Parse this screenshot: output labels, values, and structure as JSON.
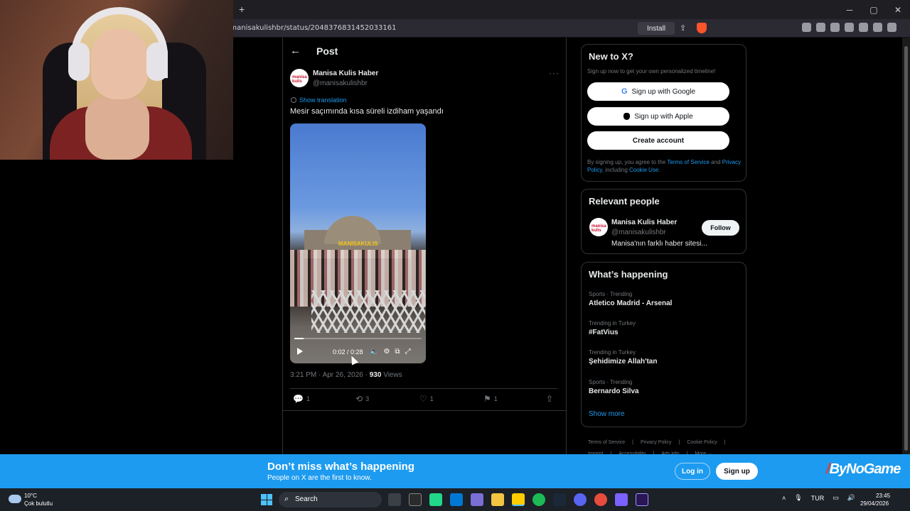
{
  "browser": {
    "new_tab": "+",
    "url": "/manisakulishbr/status/2048376831452033161",
    "install_label": "Install",
    "window_controls": [
      "─",
      "▢",
      "✕"
    ]
  },
  "post": {
    "header_title": "Post",
    "author_name": "Manisa Kulis Haber",
    "author_handle": "@manisakulishbr",
    "avatar_text": "manisa kulis",
    "show_translation": "Show translation",
    "text": "Mesir saçımında kısa süreli izdiham yaşandı",
    "video_watermark": "MANISAKULIS",
    "video_time": "0:02 / 0:28",
    "video_progress": 0.07,
    "timestamp": "3:21 PM · Apr 26, 2026 · ",
    "views_count": "930",
    "views_label": " Views",
    "replies": "1",
    "reposts": "3",
    "likes": "1",
    "bookmarks": "1"
  },
  "sidebar": {
    "signup": {
      "title": "New to X?",
      "subtitle": "Sign up now to get your own personalized timeline!",
      "google": "Sign up with Google",
      "apple": "Sign up with Apple",
      "create": "Create account",
      "terms_prefix": "By signing up, you agree to the ",
      "terms_link": "Terms of Service",
      "terms_and": " and ",
      "privacy_link": "Privacy Policy",
      "terms_including": ", including ",
      "cookie_link": "Cookie Use",
      "terms_end": "."
    },
    "people": {
      "title": "Relevant people",
      "name": "Manisa Kulis Haber",
      "handle": "@manisakulishbr",
      "bio": "Manisa'nın farklı haber sitesi...",
      "follow": "Follow"
    },
    "trends": {
      "title": "What’s happening",
      "items": [
        {
          "category": "Sports · Trending",
          "name": "Atletico Madrid - Arsenal"
        },
        {
          "category": "Trending in Turkey",
          "name": "#FatVius"
        },
        {
          "category": "Trending in Turkey",
          "name": "Şehidimize Allah'tan"
        },
        {
          "category": "Sports · Trending",
          "name": "Bernardo Silva"
        }
      ],
      "show_more": "Show more"
    },
    "footer": [
      "Terms of Service",
      "|",
      "Privacy Policy",
      "|",
      "Cookie Policy",
      "|",
      "Imprint",
      "|",
      "Accessibility",
      "|",
      "Ads info",
      "|",
      "More ···"
    ]
  },
  "banner": {
    "title": "Don’t miss what’s happening",
    "subtitle": "People on X are the first to know.",
    "login": "Log in",
    "signup": "Sign up",
    "brand": "ByNoGame"
  },
  "taskbar": {
    "temperature": "10°C",
    "weather": "Çok bulutlu",
    "search": "Search",
    "language": "TUR",
    "time": "23:45",
    "date": "29/04/2026"
  },
  "colors": {
    "accent": "#1d9bf0",
    "background": "#000000",
    "border": "#2f3336",
    "muted": "#71767b"
  }
}
